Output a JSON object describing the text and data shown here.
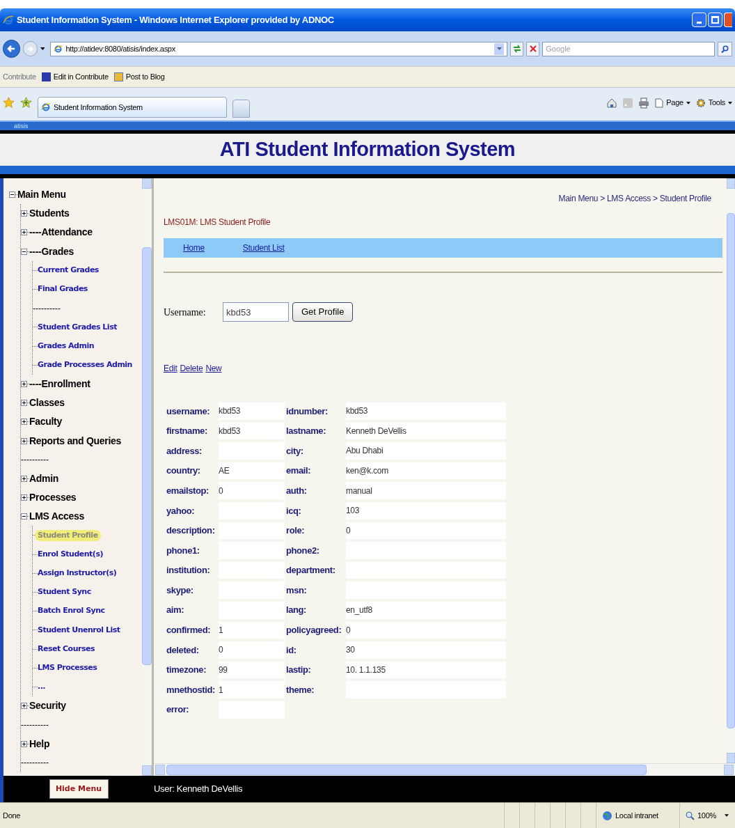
{
  "window": {
    "title": "Student Information System - Windows Internet Explorer provided by ADNOC"
  },
  "address_bar": {
    "url": "http://atidev:8080/atisis/index.aspx",
    "search_placeholder": "Google"
  },
  "links_bar": {
    "label": "Contribute",
    "items": [
      "Edit in Contribute",
      "Post to Blog"
    ]
  },
  "tabs": [
    {
      "label": "Student Information System",
      "selected": true
    }
  ],
  "command_bar": {
    "items": [
      "Page",
      "Tools"
    ]
  },
  "app_tag": "atisis",
  "app_title": "ATI Student Information System",
  "sidebar": {
    "items": [
      {
        "kind": "node",
        "label": "Main Menu",
        "expanded": true,
        "children": [
          {
            "kind": "node",
            "label": "Students",
            "expanded": false
          },
          {
            "kind": "node",
            "label": "----Attendance",
            "expanded": false
          },
          {
            "kind": "node",
            "label": "----Grades",
            "expanded": true,
            "children": [
              {
                "kind": "leaf",
                "label": "Current Grades",
                "selected": false
              },
              {
                "kind": "leaf",
                "label": "Final Grades",
                "selected": false
              },
              {
                "kind": "separator",
                "label": "----------"
              },
              {
                "kind": "leaf",
                "label": "Student Grades List",
                "selected": false
              },
              {
                "kind": "leaf",
                "label": "Grades Admin",
                "selected": false
              },
              {
                "kind": "leaf",
                "label": "Grade Processes Admin",
                "selected": false
              }
            ]
          },
          {
            "kind": "node",
            "label": "----Enrollment",
            "expanded": false
          },
          {
            "kind": "node",
            "label": "Classes",
            "expanded": false
          },
          {
            "kind": "node",
            "label": "Faculty",
            "expanded": false
          },
          {
            "kind": "node",
            "label": "Reports and Queries",
            "expanded": false
          },
          {
            "kind": "separator",
            "label": "----------"
          },
          {
            "kind": "node",
            "label": "Admin",
            "expanded": false
          },
          {
            "kind": "node",
            "label": "Processes",
            "expanded": false
          },
          {
            "kind": "node",
            "label": "LMS Access",
            "expanded": true,
            "children": [
              {
                "kind": "leaf",
                "label": "Student Profile",
                "selected": true
              },
              {
                "kind": "leaf",
                "label": "Enrol Student(s)",
                "selected": false
              },
              {
                "kind": "leaf",
                "label": "Assign Instructor(s)",
                "selected": false
              },
              {
                "kind": "leaf",
                "label": "Student Sync",
                "selected": false
              },
              {
                "kind": "leaf",
                "label": "Batch Enrol Sync",
                "selected": false
              },
              {
                "kind": "leaf",
                "label": "Student Unenrol List",
                "selected": false
              },
              {
                "kind": "leaf",
                "label": "Reset Courses",
                "selected": false
              },
              {
                "kind": "leaf",
                "label": "LMS Processes",
                "selected": false
              },
              {
                "kind": "leaf",
                "label": "...",
                "selected": false
              }
            ]
          },
          {
            "kind": "node",
            "label": "Security",
            "expanded": false
          },
          {
            "kind": "separator",
            "label": "----------"
          },
          {
            "kind": "node",
            "label": "Help",
            "expanded": false
          },
          {
            "kind": "separator",
            "label": "----------"
          }
        ]
      }
    ]
  },
  "breadcrumb": "Main Menu > LMS Access > Student Profile",
  "page_code": "LMS01M: LMS Student Profile",
  "nav_links": [
    "Home",
    "Student List"
  ],
  "lookup": {
    "label": "Username:",
    "value": "kbd53",
    "button": "Get Profile"
  },
  "actions": [
    "Edit",
    "Delete",
    "New"
  ],
  "profile": [
    {
      "label": "username:",
      "value": "kbd53"
    },
    {
      "label": "idnumber:",
      "value": "kbd53"
    },
    {
      "label": "firstname:",
      "value": "kbd53"
    },
    {
      "label": "lastname:",
      "value": "Kenneth DeVellis"
    },
    {
      "label": "address:"
    },
    {
      "label": "city:",
      "value": "Abu Dhabi"
    },
    {
      "label": "country:",
      "value": "AE"
    },
    {
      "label": "email:",
      "value": "ken@k.com"
    },
    {
      "label": "emailstop:",
      "value": "0"
    },
    {
      "label": "auth:",
      "value": "manual"
    },
    {
      "label": "yahoo:"
    },
    {
      "label": "icq:",
      "value": "103"
    },
    {
      "label": "description:"
    },
    {
      "label": "role:",
      "value": "0"
    },
    {
      "label": "phone1:"
    },
    {
      "label": "phone2:"
    },
    {
      "label": "institution:"
    },
    {
      "label": "department:"
    },
    {
      "label": "skype:"
    },
    {
      "label": "msn:"
    },
    {
      "label": "aim:"
    },
    {
      "label": "lang:",
      "value": "en_utf8"
    },
    {
      "label": "confirmed:",
      "value": "1"
    },
    {
      "label": "policyagreed:",
      "value": "0"
    },
    {
      "label": "deleted:",
      "value": "0"
    },
    {
      "label": "id:",
      "value": "30"
    },
    {
      "label": "timezone:",
      "value": "99"
    },
    {
      "label": "lastip:",
      "value": "10.  1.1.135"
    },
    {
      "label": "mnethostid:",
      "value": "1"
    },
    {
      "label": "theme:"
    },
    {
      "label": "error:"
    }
  ],
  "footer": {
    "button": "Hide Menu",
    "user": "User: Kenneth DeVellis"
  },
  "status_bar": {
    "text": "Done",
    "zone": "Local intranet",
    "zoom": "100%"
  }
}
